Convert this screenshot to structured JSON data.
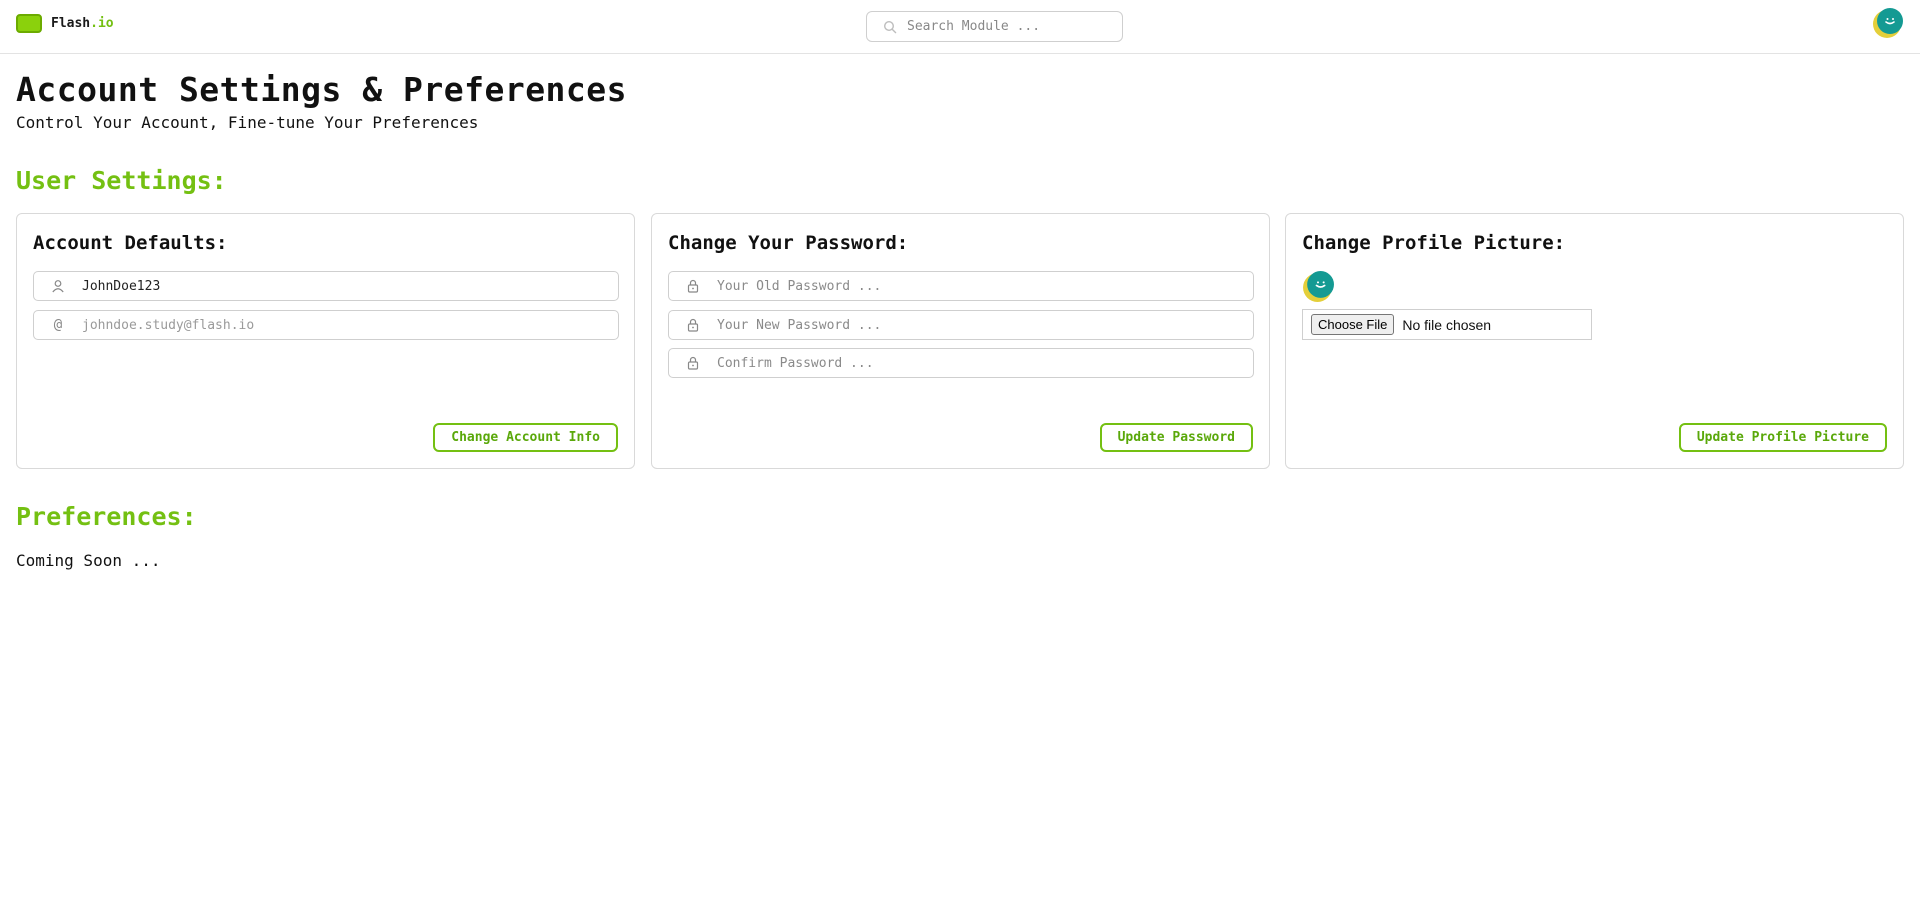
{
  "app": {
    "name_main": "Flash",
    "name_accent": ".io",
    "brand_color": "#8bd10c",
    "accent_color": "#74c012"
  },
  "search": {
    "placeholder": "Search Module ..."
  },
  "header": {
    "title": "Account Settings & Preferences",
    "subtitle": "Control Your Account, Fine-tune Your Preferences"
  },
  "user_settings": {
    "section_title": "User Settings:",
    "account_defaults": {
      "title": "Account Defaults:",
      "username_value": "JohnDoe123",
      "email_value": "johndoe.study@flash.io",
      "button_label": "Change Account Info"
    },
    "password": {
      "title": "Change Your Password:",
      "old_placeholder": "Your Old Password ...",
      "new_placeholder": "Your New Password ...",
      "confirm_placeholder": "Confirm Password ...",
      "button_label": "Update Password"
    },
    "profile_picture": {
      "title": "Change Profile Picture:",
      "file_button_label": "Choose File",
      "file_status": "No file chosen",
      "button_label": "Update Profile Picture"
    }
  },
  "preferences": {
    "section_title": "Preferences:",
    "body": "Coming Soon ..."
  }
}
